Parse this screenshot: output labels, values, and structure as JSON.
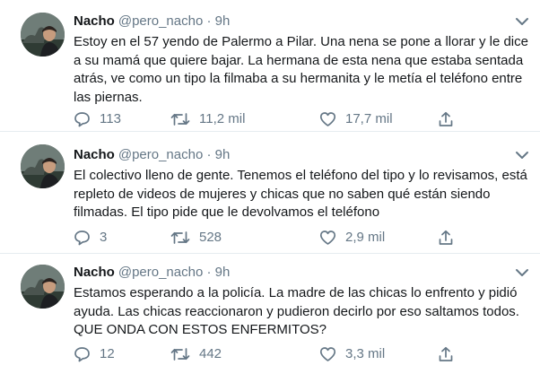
{
  "tweets": [
    {
      "name": "Nacho",
      "handle": "@pero_nacho",
      "separator": "·",
      "time": "9h",
      "text": "Estoy en el 57 yendo de Palermo a Pilar. Una nena se pone a llorar y le dice a su mamá que quiere bajar. La hermana de esta nena que estaba sentada atrás, ve como un tipo la filmaba a su hermanita y le metía el teléfono entre las piernas.",
      "replies": "113",
      "retweets": "11,2 mil",
      "likes": "17,7 mil"
    },
    {
      "name": "Nacho",
      "handle": "@pero_nacho",
      "separator": "·",
      "time": "9h",
      "text": "El colectivo lleno de gente. Tenemos el teléfono del tipo y lo revisamos, está repleto de videos de mujeres y chicas que no saben qué están siendo filmadas. El tipo pide que le devolvamos el teléfono",
      "replies": "3",
      "retweets": "528",
      "likes": "2,9 mil"
    },
    {
      "name": "Nacho",
      "handle": "@pero_nacho",
      "separator": "·",
      "time": "9h",
      "text": "Estamos esperando a la policía. La madre de las chicas lo enfrento y pidió ayuda. Las chicas reaccionaron y pudieron decirlo por eso saltamos todos. QUE ONDA CON ESTOS ENFERMITOS?",
      "replies": "12",
      "retweets": "442",
      "likes": "3,3 mil"
    }
  ],
  "icons": {
    "reply": "reply-icon",
    "retweet": "retweet-icon",
    "like": "like-icon",
    "share": "share-icon",
    "caret": "chevron-down-icon"
  },
  "colors": {
    "text": "#14171a",
    "secondary": "#657786",
    "divider": "#e6ecf0"
  }
}
